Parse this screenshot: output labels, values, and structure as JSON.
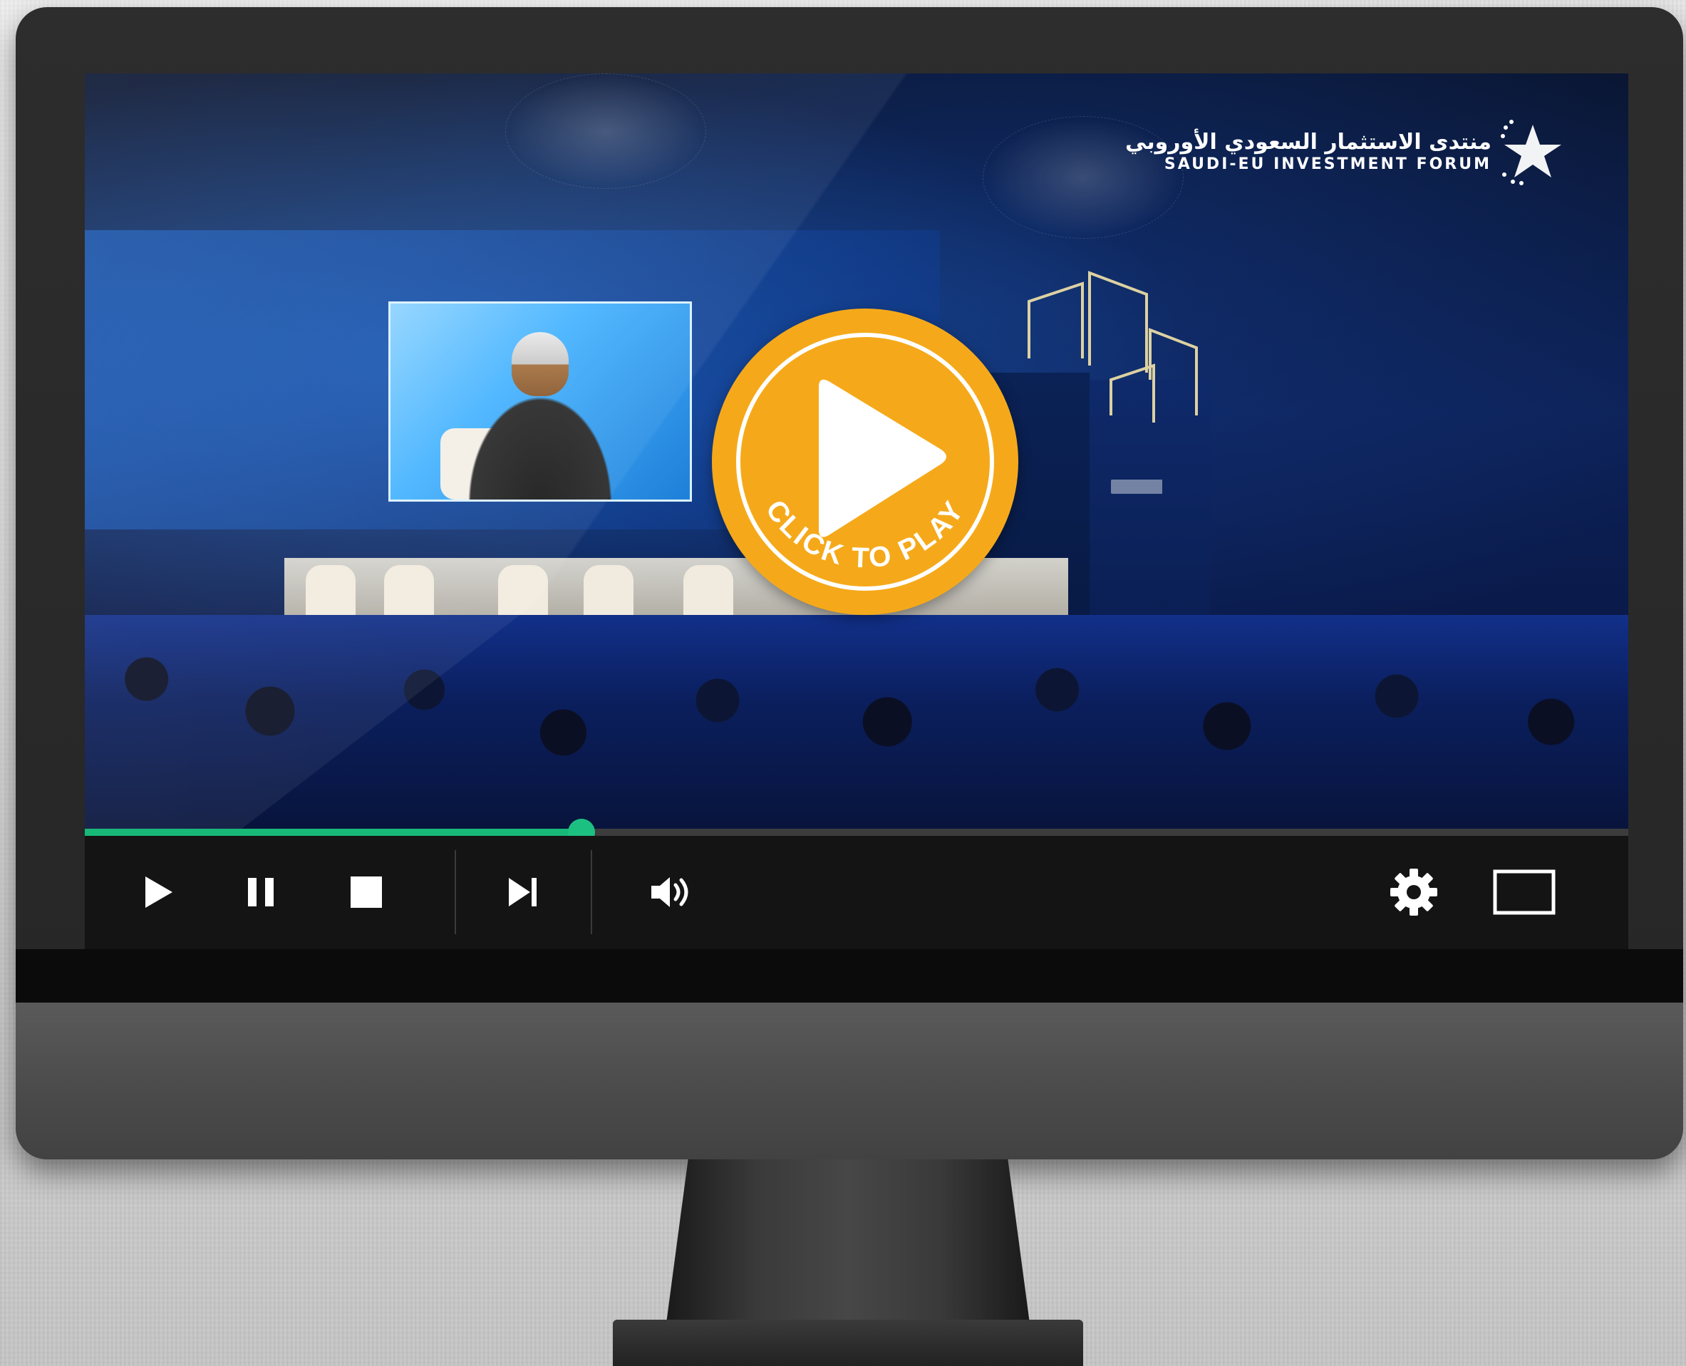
{
  "brand": {
    "arabic_name": "منتدى الاستثمار السعودي الأوروبي",
    "english_name": "SAUDI-EU INVESTMENT FORUM"
  },
  "overlay": {
    "play_caption": "CLICK TO PLAY",
    "play_color": "#f5a91a"
  },
  "player": {
    "progress": 0.322,
    "progress_color": "#18b878",
    "controls": [
      {
        "id": "play",
        "icon": "play-icon"
      },
      {
        "id": "pause",
        "icon": "pause-icon"
      },
      {
        "id": "stop",
        "icon": "stop-icon"
      },
      {
        "id": "next",
        "icon": "skip-next-icon"
      },
      {
        "id": "volume",
        "icon": "volume-icon"
      },
      {
        "id": "settings",
        "icon": "gear-icon"
      },
      {
        "id": "fullscreen",
        "icon": "fullscreen-icon"
      }
    ]
  }
}
